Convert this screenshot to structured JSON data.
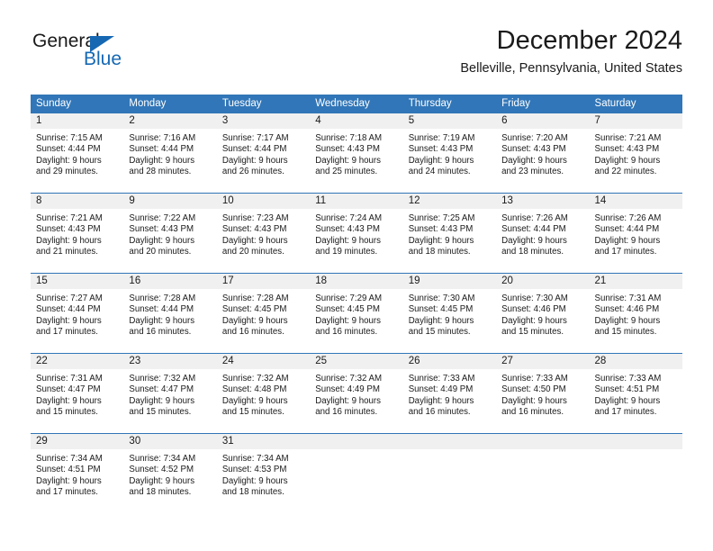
{
  "brand": {
    "name_primary": "General",
    "name_secondary": "Blue",
    "triangle_color": "#1668b3",
    "text_color": "#1a1a1a"
  },
  "header": {
    "title": "December 2024",
    "location": "Belleville, Pennsylvania, United States",
    "accent_color": "#3176b8",
    "daynum_band_color": "#f0f0f0"
  },
  "weekday_headers": [
    "Sunday",
    "Monday",
    "Tuesday",
    "Wednesday",
    "Thursday",
    "Friday",
    "Saturday"
  ],
  "weeks": [
    [
      {
        "day": "1",
        "sunrise": "Sunrise: 7:15 AM",
        "sunset": "Sunset: 4:44 PM",
        "daylight1": "Daylight: 9 hours",
        "daylight2": "and 29 minutes."
      },
      {
        "day": "2",
        "sunrise": "Sunrise: 7:16 AM",
        "sunset": "Sunset: 4:44 PM",
        "daylight1": "Daylight: 9 hours",
        "daylight2": "and 28 minutes."
      },
      {
        "day": "3",
        "sunrise": "Sunrise: 7:17 AM",
        "sunset": "Sunset: 4:44 PM",
        "daylight1": "Daylight: 9 hours",
        "daylight2": "and 26 minutes."
      },
      {
        "day": "4",
        "sunrise": "Sunrise: 7:18 AM",
        "sunset": "Sunset: 4:43 PM",
        "daylight1": "Daylight: 9 hours",
        "daylight2": "and 25 minutes."
      },
      {
        "day": "5",
        "sunrise": "Sunrise: 7:19 AM",
        "sunset": "Sunset: 4:43 PM",
        "daylight1": "Daylight: 9 hours",
        "daylight2": "and 24 minutes."
      },
      {
        "day": "6",
        "sunrise": "Sunrise: 7:20 AM",
        "sunset": "Sunset: 4:43 PM",
        "daylight1": "Daylight: 9 hours",
        "daylight2": "and 23 minutes."
      },
      {
        "day": "7",
        "sunrise": "Sunrise: 7:21 AM",
        "sunset": "Sunset: 4:43 PM",
        "daylight1": "Daylight: 9 hours",
        "daylight2": "and 22 minutes."
      }
    ],
    [
      {
        "day": "8",
        "sunrise": "Sunrise: 7:21 AM",
        "sunset": "Sunset: 4:43 PM",
        "daylight1": "Daylight: 9 hours",
        "daylight2": "and 21 minutes."
      },
      {
        "day": "9",
        "sunrise": "Sunrise: 7:22 AM",
        "sunset": "Sunset: 4:43 PM",
        "daylight1": "Daylight: 9 hours",
        "daylight2": "and 20 minutes."
      },
      {
        "day": "10",
        "sunrise": "Sunrise: 7:23 AM",
        "sunset": "Sunset: 4:43 PM",
        "daylight1": "Daylight: 9 hours",
        "daylight2": "and 20 minutes."
      },
      {
        "day": "11",
        "sunrise": "Sunrise: 7:24 AM",
        "sunset": "Sunset: 4:43 PM",
        "daylight1": "Daylight: 9 hours",
        "daylight2": "and 19 minutes."
      },
      {
        "day": "12",
        "sunrise": "Sunrise: 7:25 AM",
        "sunset": "Sunset: 4:43 PM",
        "daylight1": "Daylight: 9 hours",
        "daylight2": "and 18 minutes."
      },
      {
        "day": "13",
        "sunrise": "Sunrise: 7:26 AM",
        "sunset": "Sunset: 4:44 PM",
        "daylight1": "Daylight: 9 hours",
        "daylight2": "and 18 minutes."
      },
      {
        "day": "14",
        "sunrise": "Sunrise: 7:26 AM",
        "sunset": "Sunset: 4:44 PM",
        "daylight1": "Daylight: 9 hours",
        "daylight2": "and 17 minutes."
      }
    ],
    [
      {
        "day": "15",
        "sunrise": "Sunrise: 7:27 AM",
        "sunset": "Sunset: 4:44 PM",
        "daylight1": "Daylight: 9 hours",
        "daylight2": "and 17 minutes."
      },
      {
        "day": "16",
        "sunrise": "Sunrise: 7:28 AM",
        "sunset": "Sunset: 4:44 PM",
        "daylight1": "Daylight: 9 hours",
        "daylight2": "and 16 minutes."
      },
      {
        "day": "17",
        "sunrise": "Sunrise: 7:28 AM",
        "sunset": "Sunset: 4:45 PM",
        "daylight1": "Daylight: 9 hours",
        "daylight2": "and 16 minutes."
      },
      {
        "day": "18",
        "sunrise": "Sunrise: 7:29 AM",
        "sunset": "Sunset: 4:45 PM",
        "daylight1": "Daylight: 9 hours",
        "daylight2": "and 16 minutes."
      },
      {
        "day": "19",
        "sunrise": "Sunrise: 7:30 AM",
        "sunset": "Sunset: 4:45 PM",
        "daylight1": "Daylight: 9 hours",
        "daylight2": "and 15 minutes."
      },
      {
        "day": "20",
        "sunrise": "Sunrise: 7:30 AM",
        "sunset": "Sunset: 4:46 PM",
        "daylight1": "Daylight: 9 hours",
        "daylight2": "and 15 minutes."
      },
      {
        "day": "21",
        "sunrise": "Sunrise: 7:31 AM",
        "sunset": "Sunset: 4:46 PM",
        "daylight1": "Daylight: 9 hours",
        "daylight2": "and 15 minutes."
      }
    ],
    [
      {
        "day": "22",
        "sunrise": "Sunrise: 7:31 AM",
        "sunset": "Sunset: 4:47 PM",
        "daylight1": "Daylight: 9 hours",
        "daylight2": "and 15 minutes."
      },
      {
        "day": "23",
        "sunrise": "Sunrise: 7:32 AM",
        "sunset": "Sunset: 4:47 PM",
        "daylight1": "Daylight: 9 hours",
        "daylight2": "and 15 minutes."
      },
      {
        "day": "24",
        "sunrise": "Sunrise: 7:32 AM",
        "sunset": "Sunset: 4:48 PM",
        "daylight1": "Daylight: 9 hours",
        "daylight2": "and 15 minutes."
      },
      {
        "day": "25",
        "sunrise": "Sunrise: 7:32 AM",
        "sunset": "Sunset: 4:49 PM",
        "daylight1": "Daylight: 9 hours",
        "daylight2": "and 16 minutes."
      },
      {
        "day": "26",
        "sunrise": "Sunrise: 7:33 AM",
        "sunset": "Sunset: 4:49 PM",
        "daylight1": "Daylight: 9 hours",
        "daylight2": "and 16 minutes."
      },
      {
        "day": "27",
        "sunrise": "Sunrise: 7:33 AM",
        "sunset": "Sunset: 4:50 PM",
        "daylight1": "Daylight: 9 hours",
        "daylight2": "and 16 minutes."
      },
      {
        "day": "28",
        "sunrise": "Sunrise: 7:33 AM",
        "sunset": "Sunset: 4:51 PM",
        "daylight1": "Daylight: 9 hours",
        "daylight2": "and 17 minutes."
      }
    ],
    [
      {
        "day": "29",
        "sunrise": "Sunrise: 7:34 AM",
        "sunset": "Sunset: 4:51 PM",
        "daylight1": "Daylight: 9 hours",
        "daylight2": "and 17 minutes."
      },
      {
        "day": "30",
        "sunrise": "Sunrise: 7:34 AM",
        "sunset": "Sunset: 4:52 PM",
        "daylight1": "Daylight: 9 hours",
        "daylight2": "and 18 minutes."
      },
      {
        "day": "31",
        "sunrise": "Sunrise: 7:34 AM",
        "sunset": "Sunset: 4:53 PM",
        "daylight1": "Daylight: 9 hours",
        "daylight2": "and 18 minutes."
      },
      {
        "day": "",
        "sunrise": "",
        "sunset": "",
        "daylight1": "",
        "daylight2": ""
      },
      {
        "day": "",
        "sunrise": "",
        "sunset": "",
        "daylight1": "",
        "daylight2": ""
      },
      {
        "day": "",
        "sunrise": "",
        "sunset": "",
        "daylight1": "",
        "daylight2": ""
      },
      {
        "day": "",
        "sunrise": "",
        "sunset": "",
        "daylight1": "",
        "daylight2": ""
      }
    ]
  ]
}
